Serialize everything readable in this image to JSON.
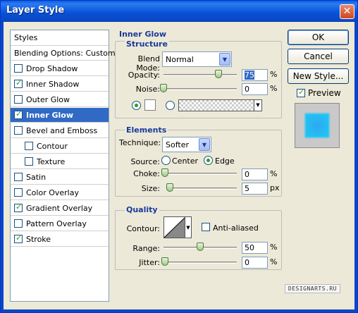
{
  "window": {
    "title": "Layer Style",
    "close_glyph": "✕"
  },
  "styles_list": {
    "header": "Styles",
    "blending_options": "Blending Options: Custom",
    "items": [
      {
        "label": "Drop Shadow",
        "checked": false
      },
      {
        "label": "Inner Shadow",
        "checked": true
      },
      {
        "label": "Outer Glow",
        "checked": false
      },
      {
        "label": "Inner Glow",
        "checked": true,
        "selected": true
      },
      {
        "label": "Bevel and Emboss",
        "checked": false
      },
      {
        "label": "Contour",
        "checked": false,
        "sub": true
      },
      {
        "label": "Texture",
        "checked": false,
        "sub": true
      },
      {
        "label": "Satin",
        "checked": false
      },
      {
        "label": "Color Overlay",
        "checked": false
      },
      {
        "label": "Gradient Overlay",
        "checked": true
      },
      {
        "label": "Pattern Overlay",
        "checked": false
      },
      {
        "label": "Stroke",
        "checked": true
      }
    ]
  },
  "inner_glow": {
    "title": "Inner Glow",
    "structure": {
      "title": "Structure",
      "blend_mode_label": "Blend Mode:",
      "blend_mode_value": "Normal",
      "opacity_label": "Opacity:",
      "opacity_value": "75",
      "opacity_unit": "%",
      "opacity_level": 75,
      "noise_label": "Noise:",
      "noise_value": "0",
      "noise_unit": "%",
      "noise_level": 0
    },
    "elements": {
      "title": "Elements",
      "technique_label": "Technique:",
      "technique_value": "Softer",
      "source_label": "Source:",
      "source_center": "Center",
      "source_edge": "Edge",
      "choke_label": "Choke:",
      "choke_value": "0",
      "choke_unit": "%",
      "size_label": "Size:",
      "size_value": "5",
      "size_unit": "px"
    },
    "quality": {
      "title": "Quality",
      "contour_label": "Contour:",
      "anti_aliased_label": "Anti-aliased",
      "range_label": "Range:",
      "range_value": "50",
      "range_unit": "%",
      "range_level": 50,
      "jitter_label": "Jitter:",
      "jitter_value": "0",
      "jitter_unit": "%"
    }
  },
  "buttons": {
    "ok": "OK",
    "cancel": "Cancel",
    "new_style": "New Style..."
  },
  "preview": {
    "label": "Preview",
    "checked": true
  },
  "watermark": "DESIGNARTS.RU",
  "colors": {
    "selection": "#316ac5",
    "section_title": "#1a3a9c",
    "glow": "#2fa8f0"
  }
}
